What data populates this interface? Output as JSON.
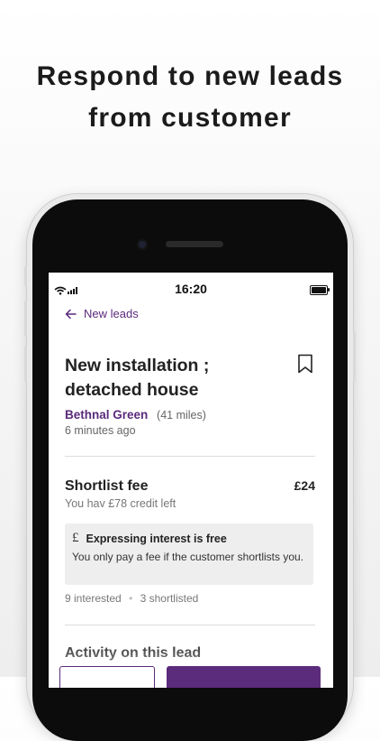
{
  "headline": {
    "line1": "Respond to new leads",
    "line2": "from customer"
  },
  "status_bar": {
    "time": "16:20",
    "icons": [
      "wifi-icon",
      "signal-icon",
      "battery-icon"
    ]
  },
  "nav": {
    "back_label": "New leads",
    "back_icon": "arrow-left-icon"
  },
  "lead": {
    "title_line1": "New installation ;",
    "title_line2": "detached house",
    "location": "Bethnal Green",
    "distance": "(41 miles)",
    "posted": "6 minutes ago",
    "bookmark_icon": "bookmark-icon"
  },
  "fee": {
    "title": "Shortlist fee",
    "amount": "£24",
    "credit": "You hav £78 credit left"
  },
  "info_box": {
    "icon": "pound-icon",
    "icon_glyph": "£",
    "title": "Expressing interest is free",
    "text": "You only pay a fee if the customer shortlists you."
  },
  "stats": {
    "interested": "9 interested",
    "shortlisted": "3 shortlisted"
  },
  "activity": {
    "title": "Activity on this lead"
  },
  "colors": {
    "brand": "#5b2b7c",
    "link": "#5a2a7a",
    "info_bg": "#eeeeee"
  }
}
